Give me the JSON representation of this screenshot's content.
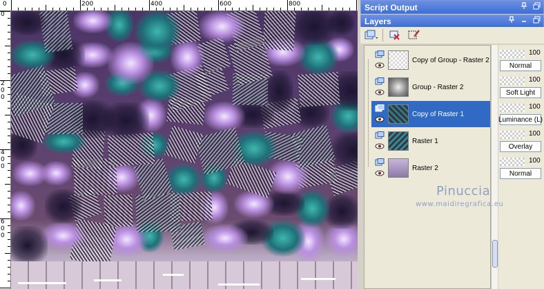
{
  "ruler": {
    "top_labels": [
      "0",
      "200",
      "400",
      "600",
      "800"
    ],
    "left_labels": [
      "0",
      "200",
      "400",
      "600"
    ]
  },
  "script_output": {
    "title": "Script Output",
    "pin_icon": "pin-icon",
    "float_icon": "restore-icon"
  },
  "layers": {
    "title": "Layers",
    "toolbar": {
      "new_layer_icon": "new-raster-layer-icon",
      "delete_icon": "delete-layer-icon",
      "edit_icon": "edit-selection-icon"
    },
    "items": [
      {
        "name": "Copy of Group - Raster 2",
        "opacity": "100",
        "blend": "Normal",
        "selected": false
      },
      {
        "name": "Group - Raster 2",
        "opacity": "100",
        "blend": "Soft Light",
        "selected": false
      },
      {
        "name": "Copy of Raster 1",
        "opacity": "100",
        "blend": "Luminance (L)",
        "selected": true
      },
      {
        "name": "Raster 1",
        "opacity": "100",
        "blend": "Overlay",
        "selected": false
      },
      {
        "name": "Raster 2",
        "opacity": "100",
        "blend": "Normal",
        "selected": false
      }
    ]
  },
  "watermark": {
    "name": "Pinuccia",
    "url": "www.maidiregrafica.eu"
  },
  "colors": {
    "title_bar": "#3c6fd6",
    "selection": "#316ac5",
    "panel_bg": "#ece9d8"
  }
}
